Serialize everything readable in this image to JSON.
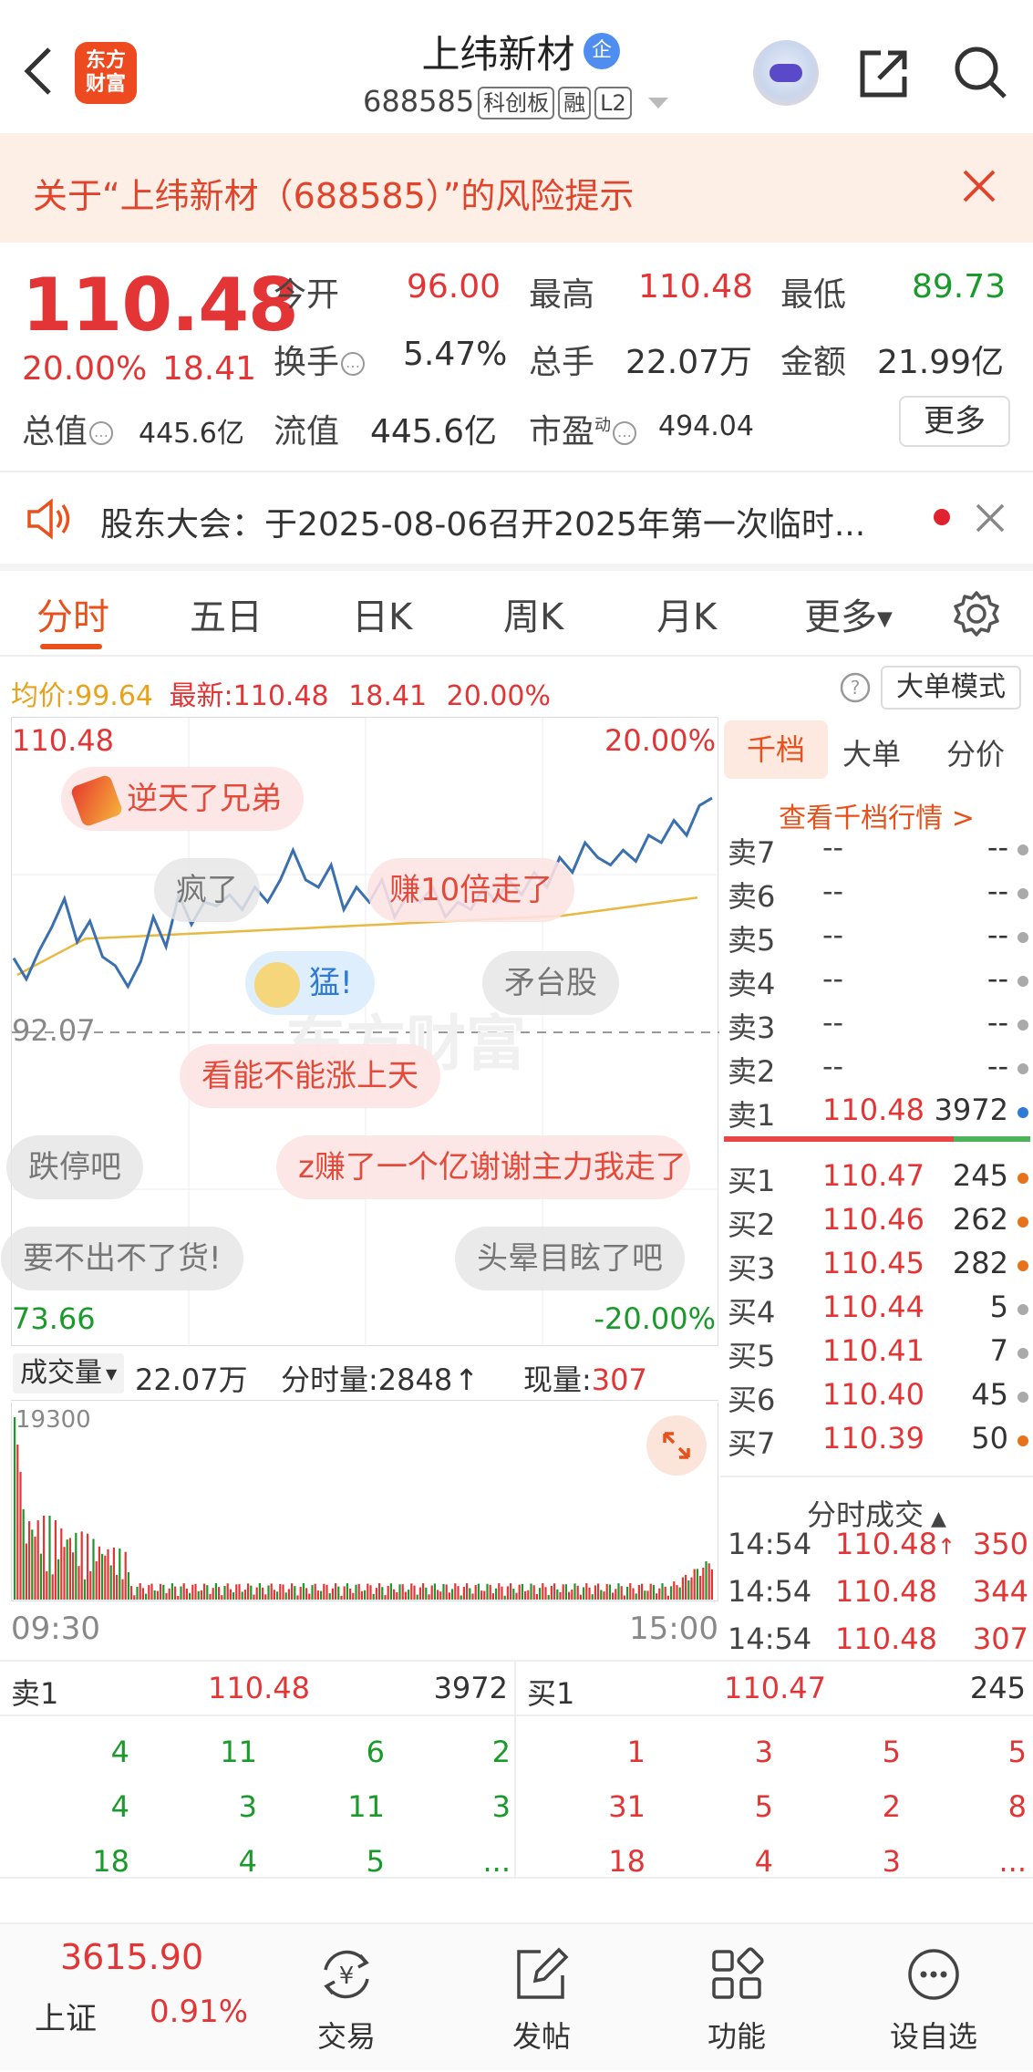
{
  "header": {
    "stock_name": "上纬新材",
    "enterprise_badge": "企",
    "code": "688585",
    "tags": [
      "科创板",
      "融",
      "L2"
    ],
    "logo_text": [
      "东方",
      "财富"
    ]
  },
  "risk_banner": {
    "text": "关于“上纬新材（688585）”的风险提示"
  },
  "quote": {
    "price": "110.48",
    "change_pct": "20.00%",
    "change": "18.41",
    "labels": {
      "open": "今开",
      "high": "最高",
      "low": "最低",
      "turnover": "换手",
      "volume": "总手",
      "amount": "金额",
      "mktcap": "总值",
      "float": "流值",
      "pe": "市盈",
      "pe_sup": "动",
      "more": "更多"
    },
    "open": "96.00",
    "high": "110.48",
    "low": "89.73",
    "turnover": "5.47%",
    "volume": "22.07万",
    "amount": "21.99亿",
    "mktcap": "445.6亿",
    "float": "445.6亿",
    "pe": "494.04"
  },
  "notice": {
    "text": "股东大会：于2025-08-06召开2025年第一次临时..."
  },
  "tabs": [
    "分时",
    "五日",
    "日K",
    "周K",
    "月K",
    "更多"
  ],
  "avg_bar": {
    "avg_label": "均价:",
    "avg": "99.64",
    "last_label": "最新:",
    "last": "110.48",
    "chg": "18.41",
    "pct": "20.00%",
    "mode_btn": "大单模式"
  },
  "chart_labels": {
    "top_price": "110.48",
    "top_pct": "20.00%",
    "mid_price": "92.07",
    "bot_price": "73.66",
    "bot_pct": "-20.00%",
    "start_time": "09:30",
    "end_time": "15:00"
  },
  "volume_bar": {
    "dropdown": "成交量",
    "total": "22.07万",
    "tick_label": "分时量:2848",
    "now_label": "现量:",
    "now": "307",
    "max_label": "19300"
  },
  "danmaku": [
    "逆天了兄弟",
    "疯了",
    "赚10倍走了",
    "猛!",
    "矛台股",
    "看能不能涨上天",
    "跌停吧",
    "z赚了一个亿谢谢主力我走了",
    "要不出不了货!",
    "头晕目眩了吧"
  ],
  "side_tabs": [
    "千档",
    "大单",
    "分价"
  ],
  "side_link": "查看千档行情 >",
  "order_book": {
    "asks": [
      {
        "name": "卖7",
        "price": "--",
        "vol": "--"
      },
      {
        "name": "卖6",
        "price": "--",
        "vol": "--"
      },
      {
        "name": "卖5",
        "price": "--",
        "vol": "--"
      },
      {
        "name": "卖4",
        "price": "--",
        "vol": "--"
      },
      {
        "name": "卖3",
        "price": "--",
        "vol": "--"
      },
      {
        "name": "卖2",
        "price": "--",
        "vol": "--"
      },
      {
        "name": "卖1",
        "price": "110.48",
        "vol": "3972"
      }
    ],
    "bids": [
      {
        "name": "买1",
        "price": "110.47",
        "vol": "245"
      },
      {
        "name": "买2",
        "price": "110.46",
        "vol": "262"
      },
      {
        "name": "买3",
        "price": "110.45",
        "vol": "282"
      },
      {
        "name": "买4",
        "price": "110.44",
        "vol": "5"
      },
      {
        "name": "买5",
        "price": "110.41",
        "vol": "7"
      },
      {
        "name": "买6",
        "price": "110.40",
        "vol": "45"
      },
      {
        "name": "买7",
        "price": "110.39",
        "vol": "50"
      }
    ]
  },
  "ticks_title": "分时成交",
  "ticks": [
    {
      "time": "14:54",
      "price": "110.48",
      "vol": "350"
    },
    {
      "time": "14:54",
      "price": "110.48",
      "vol": "344"
    },
    {
      "time": "14:54",
      "price": "110.48",
      "vol": "307"
    }
  ],
  "queue": {
    "sell": {
      "label": "卖1",
      "price": "110.48",
      "vol": "3972",
      "rows": [
        [
          "4",
          "11",
          "6",
          "2"
        ],
        [
          "4",
          "3",
          "11",
          "3"
        ],
        [
          "18",
          "4",
          "5",
          "..."
        ]
      ]
    },
    "buy": {
      "label": "买1",
      "price": "110.47",
      "vol": "245",
      "rows": [
        [
          "1",
          "3",
          "5",
          "5"
        ],
        [
          "31",
          "5",
          "2",
          "8"
        ],
        [
          "18",
          "4",
          "3",
          "..."
        ]
      ]
    }
  },
  "footer": {
    "index_value": "3615.90",
    "index_name": "上证",
    "index_pct": "0.91%",
    "items": [
      "交易",
      "发帖",
      "功能",
      "设自选"
    ]
  },
  "colors": {
    "up": "#e33535",
    "down": "#1a9a2a",
    "accent": "#e8511c",
    "price_line": "#3a6fb0",
    "avg_line": "#e8b840"
  },
  "icons": [
    "back-icon",
    "share-icon",
    "search-icon",
    "close-icon",
    "speaker-icon",
    "settings-icon",
    "help-icon",
    "expand-icon",
    "trade-icon",
    "post-icon",
    "function-icon",
    "watchlist-icon"
  ]
}
